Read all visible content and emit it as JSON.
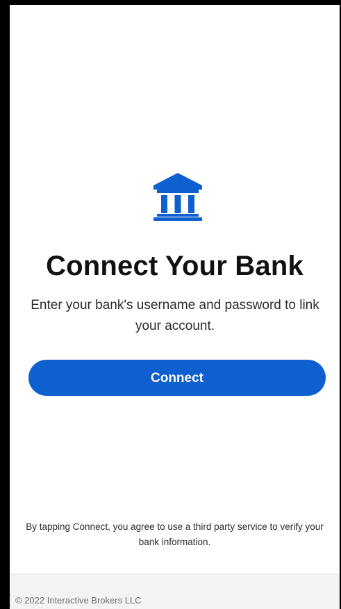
{
  "screen": {
    "icon": "bank-icon",
    "title": "Connect Your Bank",
    "subtitle": "Enter your bank's username and password to link your account.",
    "connect_button": "Connect",
    "disclaimer": "By tapping Connect, you agree to use a third party service to verify your bank information.",
    "footer_copyright": "© 2022 Interactive Brokers LLC"
  },
  "colors": {
    "accent": "#0e5fcf",
    "background": "#ffffff",
    "footer_background": "#f2f3f5",
    "title_text": "#111111"
  }
}
